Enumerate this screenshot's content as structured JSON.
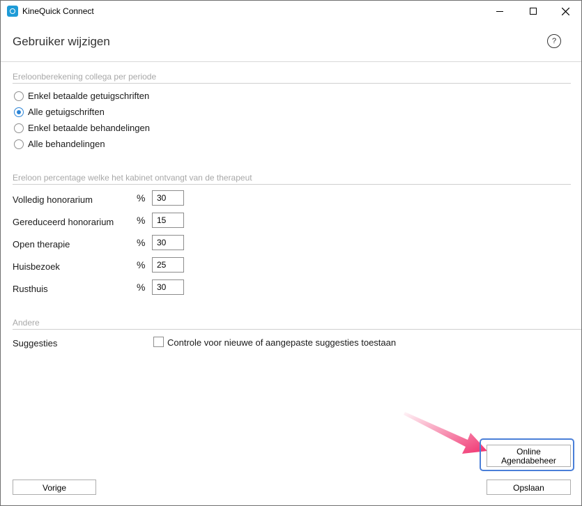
{
  "window": {
    "app_title": "KineQuick Connect"
  },
  "header": {
    "title": "Gebruiker wijzigen",
    "help_label": "?"
  },
  "sections": {
    "ereloon_berekening": {
      "title": "Ereloonberekening collega per periode",
      "options": [
        {
          "label": "Enkel betaalde getuigschriften",
          "checked": false
        },
        {
          "label": "Alle getuigschriften",
          "checked": true
        },
        {
          "label": "Enkel betaalde behandelingen",
          "checked": false
        },
        {
          "label": "Alle behandelingen",
          "checked": false
        }
      ]
    },
    "ereloon_percentage": {
      "title": "Ereloon percentage welke het kabinet ontvangt van de therapeut",
      "rows": [
        {
          "label": "Volledig honorarium",
          "unit": "%",
          "value": "30"
        },
        {
          "label": "Gereduceerd honorarium",
          "unit": "%",
          "value": "15"
        },
        {
          "label": "Open therapie",
          "unit": "%",
          "value": "30"
        },
        {
          "label": "Huisbezoek",
          "unit": "%",
          "value": "25"
        },
        {
          "label": "Rusthuis",
          "unit": "%",
          "value": "30"
        }
      ]
    },
    "andere": {
      "title": "Andere",
      "suggesties_label": "Suggesties",
      "checkbox_label": "Controle voor nieuwe of aangepaste suggesties toestaan",
      "checkbox_checked": false
    }
  },
  "buttons": {
    "online_line1": "Online",
    "online_line2": "Agendabeheer",
    "previous": "Vorige",
    "save": "Opslaan"
  },
  "colors": {
    "accent": "#2b84d6",
    "focus_border": "#4a7fd8",
    "annotation_arrow": "#f0306e",
    "section_title": "#a8a8a8"
  }
}
